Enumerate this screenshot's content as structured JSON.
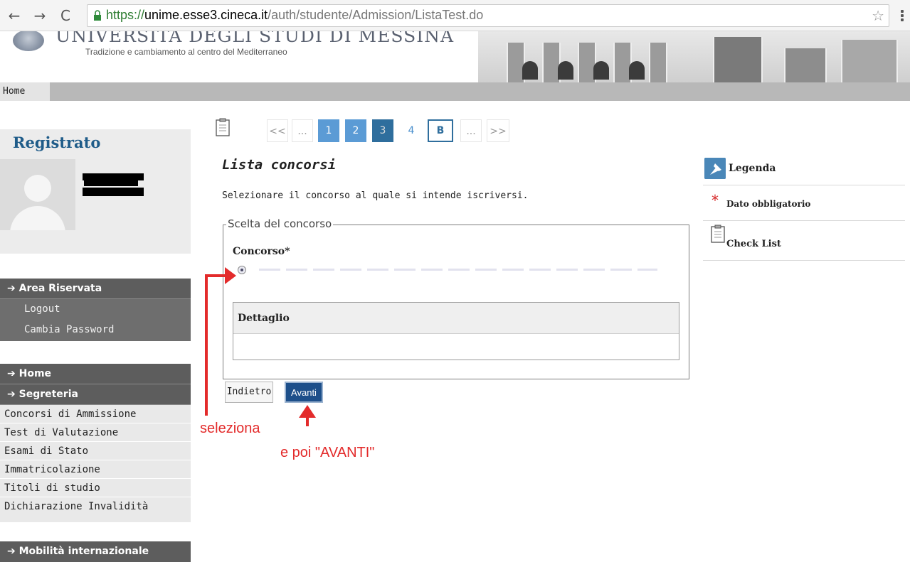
{
  "browser": {
    "url_scheme": "https://",
    "url_host": "unime.esse3.cineca.it",
    "url_path": "/auth/studente/Admission/ListaTest.do"
  },
  "header": {
    "university_name": "UNIVERSITA DEGLI STUDI DI MESSINA",
    "motto": "Tradizione e cambiamento al centro del Mediterraneo"
  },
  "navbar": {
    "home": "Home"
  },
  "sidebar": {
    "title": "Registrato",
    "area_riservata": {
      "heading": "Area Riservata",
      "items": [
        "Logout",
        "Cambia Password"
      ]
    },
    "home": "Home",
    "segreteria": {
      "heading": "Segreteria",
      "items": [
        "Concorsi di Ammissione",
        "Test di Valutazione",
        "Esami di Stato",
        "Immatricolazione",
        "Titoli di studio",
        "Dichiarazione Invalidità"
      ]
    },
    "mobilita": "Mobilità internazionale"
  },
  "pagination": {
    "first": "<<",
    "ellipsis_left": "...",
    "pages": [
      "1",
      "2",
      "3",
      "4"
    ],
    "current_marker": "B",
    "ellipsis_right": "...",
    "last": ">>"
  },
  "main": {
    "title": "Lista concorsi",
    "description": "Selezionare il concorso al quale si intende iscriversi.",
    "fieldset_legend": "Scelta del concorso",
    "concorso_label": "Concorso*",
    "dettaglio_label": "Dettaglio",
    "back_button": "Indietro",
    "next_button": "Avanti"
  },
  "annotations": {
    "select": "seleziona",
    "then_next": "e poi \"AVANTI\""
  },
  "legend_panel": {
    "title": "Legenda",
    "required": "Dato obbligatorio",
    "required_symbol": "*",
    "checklist": "Check List"
  },
  "colors": {
    "accent_blue": "#1f5c89",
    "page_blue": "#5b9bd5",
    "annotation_red": "#e32b2b",
    "sidebar_gray": "#6e6e6e"
  },
  "icons": {
    "back": "arrow-left-icon",
    "forward": "arrow-right-icon",
    "reload": "reload-icon",
    "lock": "lock-icon",
    "bookmark": "star-icon",
    "menu": "menu-icon",
    "legend": "pin-icon",
    "checklist": "clipboard-icon"
  }
}
